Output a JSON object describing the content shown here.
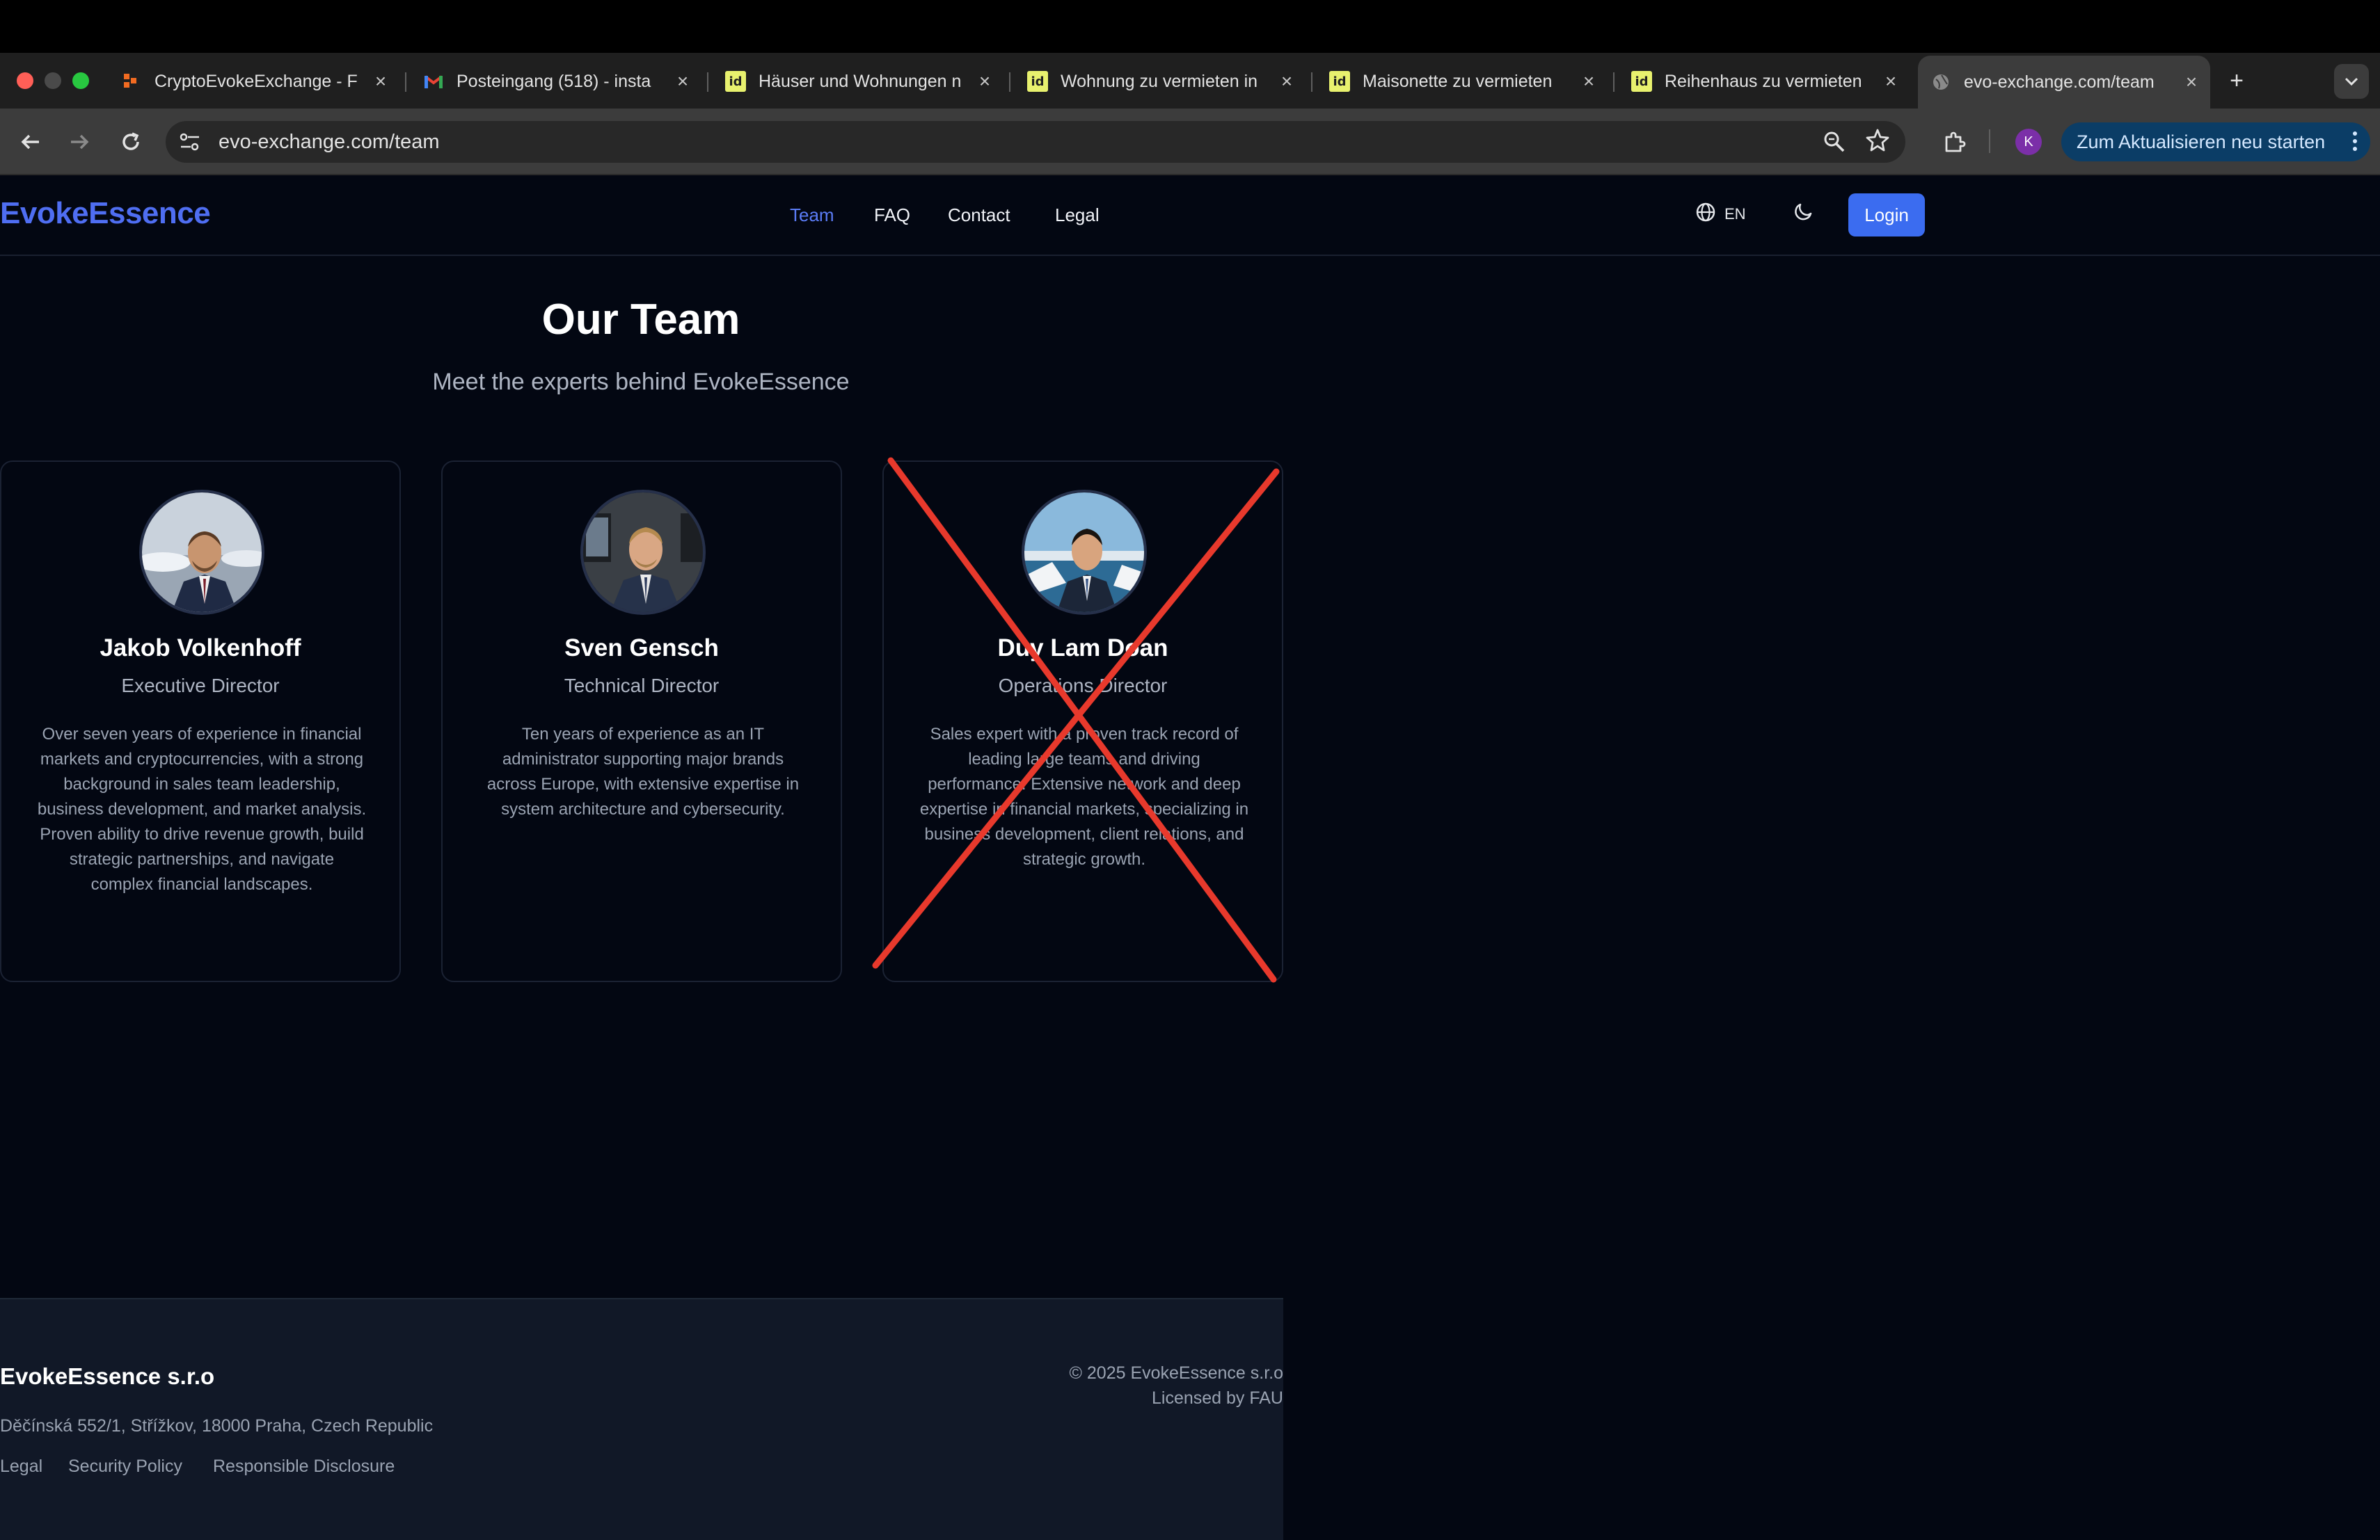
{
  "browser": {
    "tabs": [
      {
        "title": "CryptoEvokeExchange - F",
        "favicon": "orange-logo-icon"
      },
      {
        "title": "Posteingang (518) - insta",
        "favicon": "gmail-icon"
      },
      {
        "title": "Häuser und Wohnungen n",
        "favicon": "id-icon"
      },
      {
        "title": "Wohnung zu vermieten in",
        "favicon": "id-icon"
      },
      {
        "title": "Maisonette zu vermieten",
        "favicon": "id-icon"
      },
      {
        "title": "Reihenhaus zu vermieten",
        "favicon": "id-icon"
      },
      {
        "title": "evo-exchange.com/team",
        "favicon": "globe-icon"
      }
    ],
    "favicon_id_label": "id",
    "new_tab": "+",
    "url": "evo-exchange.com/team",
    "profile_initial": "K",
    "update_label": "Zum Aktualisieren neu starten",
    "colors": {
      "accent": "#3b6cf0",
      "logo": "#4f6ef2",
      "update_bg": "#0b3d66",
      "x_mark": "#e8392c"
    }
  },
  "nav": {
    "logo": "EvokeEssence",
    "links": [
      "Team",
      "FAQ",
      "Contact",
      "Legal"
    ],
    "active": "Team",
    "language": "EN",
    "login": "Login"
  },
  "main": {
    "title": "Our Team",
    "subtitle": "Meet the experts behind EvokeEssence",
    "members": [
      {
        "name": "Jakob Volkenhoff",
        "role": "Executive Director",
        "bio": "Over seven years of experience in financial markets and cryptocurrencies, with a strong background in sales team leadership, business development, and market analysis. Proven ability to drive revenue growth, build strategic partnerships, and navigate complex financial landscapes."
      },
      {
        "name": "Sven Gensch",
        "role": "Technical Director",
        "bio": "Ten years of experience as an IT administrator supporting major brands across Europe, with extensive expertise in system architecture and cybersecurity."
      },
      {
        "name": "Duy Lam Doan",
        "role": "Operations Director",
        "bio": "Sales expert with a proven track record of leading large teams and driving performance. Extensive network and deep expertise in financial markets, specializing in business development, client relations, and strategic growth.",
        "crossed_out": true
      }
    ]
  },
  "footer": {
    "company": "EvokeEssence s.r.o",
    "address": "Děčínská 552/1, Střížkov, 18000 Praha, Czech Republic",
    "links": [
      "Legal",
      "Security Policy",
      "Responsible Disclosure"
    ],
    "copyright": "© 2025 EvokeEssence s.r.o",
    "license": "Licensed by FAU"
  }
}
